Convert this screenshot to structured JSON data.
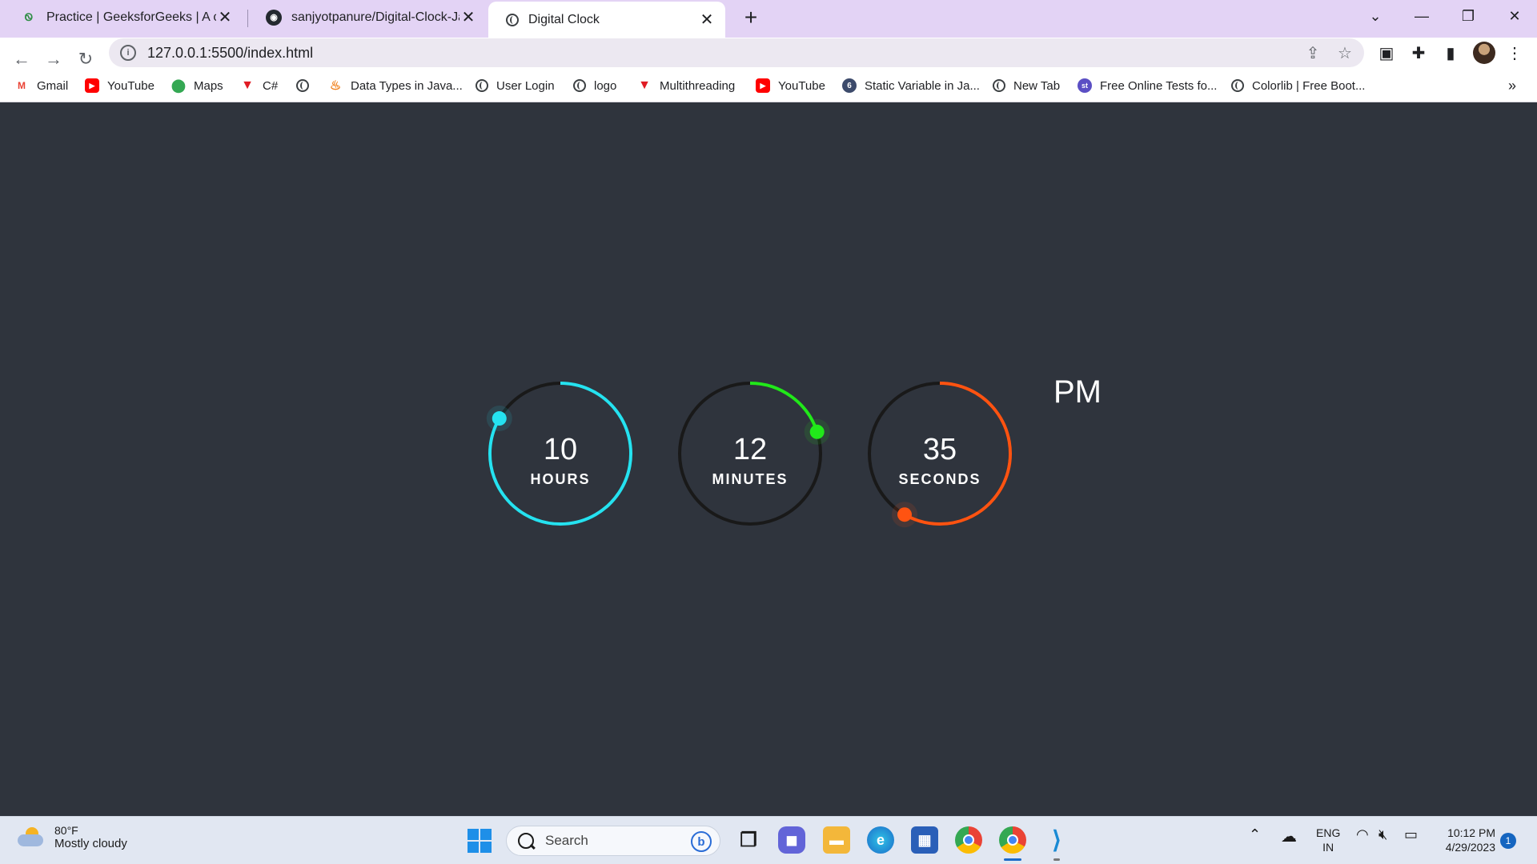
{
  "browser": {
    "tabs": [
      {
        "title": "Practice | GeeksforGeeks | A com",
        "icon": "geeksforgeeks-icon"
      },
      {
        "title": "sanjyotpanure/Digital-Clock-Java",
        "icon": "github-icon"
      },
      {
        "title": "Digital Clock",
        "icon": "globe-icon"
      }
    ],
    "url": "127.0.0.1:5500/index.html",
    "bookmarks": [
      {
        "label": "Gmail"
      },
      {
        "label": "YouTube"
      },
      {
        "label": "Maps"
      },
      {
        "label": "C#"
      },
      {
        "label": ""
      },
      {
        "label": "Data Types in Java..."
      },
      {
        "label": "User Login"
      },
      {
        "label": "logo"
      },
      {
        "label": "Multithreading"
      },
      {
        "label": "YouTube"
      },
      {
        "label": "Static Variable in Ja..."
      },
      {
        "label": "New Tab"
      },
      {
        "label": "Free Online Tests fo..."
      },
      {
        "label": "Colorlib | Free Boot..."
      }
    ],
    "bookmarks_overflow": "»"
  },
  "clock": {
    "hours": {
      "value": "10",
      "label": "HOURS",
      "color": "#25e2f0",
      "fraction": 0.8333
    },
    "minutes": {
      "value": "12",
      "label": "MINUTES",
      "color": "#21e81a",
      "fraction": 0.2
    },
    "seconds": {
      "value": "35",
      "label": "SECONDS",
      "color": "#ff5311",
      "fraction": 0.5833
    },
    "ampm": "PM"
  },
  "taskbar": {
    "weather_temp": "80°F",
    "weather_desc": "Mostly cloudy",
    "search_placeholder": "Search",
    "lang_line1": "ENG",
    "lang_line2": "IN",
    "time": "10:12 PM",
    "date": "4/29/2023",
    "notifications": "1"
  }
}
